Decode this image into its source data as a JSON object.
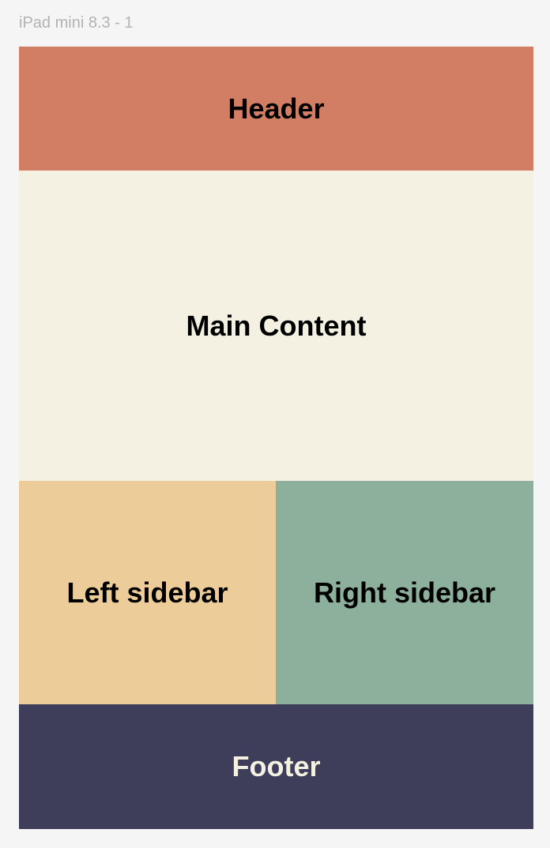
{
  "frame": {
    "label": "iPad mini 8.3 - 1"
  },
  "layout": {
    "header": {
      "label": "Header",
      "color": "#d27e65",
      "text_color": "#000000"
    },
    "main": {
      "label": "Main Content",
      "color": "#f5f1e2",
      "text_color": "#000000"
    },
    "left_sidebar": {
      "label": "Left sidebar",
      "color": "#eccc98",
      "text_color": "#000000"
    },
    "right_sidebar": {
      "label": "Right sidebar",
      "color": "#8cb09b",
      "text_color": "#000000"
    },
    "footer": {
      "label": "Footer",
      "color": "#3e3e5b",
      "text_color": "#f5f1e2"
    }
  }
}
